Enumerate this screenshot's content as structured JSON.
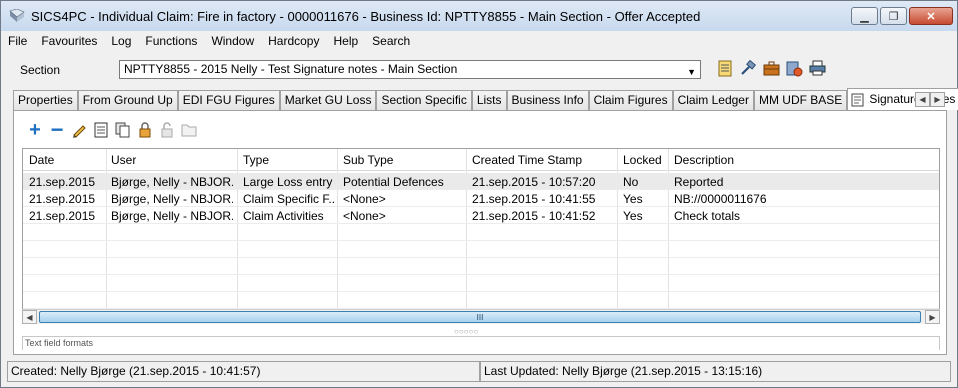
{
  "window": {
    "title": "SICS4PC - Individual Claim: Fire in factory - 0000011676 - Business Id: NPTTY8855 - Main Section - Offer Accepted",
    "controls": [
      "minimize",
      "maximize",
      "close"
    ]
  },
  "menu": [
    "File",
    "Favourites",
    "Log",
    "Functions",
    "Window",
    "Hardcopy",
    "Help",
    "Search"
  ],
  "section": {
    "label": "Section",
    "value": "NPTTY8855 - 2015 Nelly - Test Signature notes - Main Section"
  },
  "tabs": [
    "Properties",
    "From Ground Up",
    "EDI FGU Figures",
    "Market GU Loss",
    "Section Specific",
    "Lists",
    "Business Info",
    "Claim Figures",
    "Claim Ledger",
    "MM UDF BASE",
    "Signature Notes"
  ],
  "active_tab": "Signature Notes",
  "grid": {
    "columns": [
      "Date",
      "User",
      "Type",
      "Sub Type",
      "Created Time Stamp",
      "Locked",
      "Description"
    ],
    "rows": [
      [
        "21.sep.2015",
        "Bjørge, Nelly - NBJOR...",
        "Large Loss entry",
        "Potential Defences",
        "21.sep.2015 - 10:57:20",
        "No",
        "Reported"
      ],
      [
        "21.sep.2015",
        "Bjørge, Nelly - NBJOR...",
        "Claim Specific F...",
        "<None>",
        "21.sep.2015 - 10:41:55",
        "Yes",
        "NB://0000011676"
      ],
      [
        "21.sep.2015",
        "Bjørge, Nelly - NBJOR...",
        "Claim Activities",
        "<None>",
        "21.sep.2015 - 10:41:52",
        "Yes",
        "Check totals"
      ]
    ]
  },
  "scroll": {
    "thumb_label": "III"
  },
  "splitter_label": "○○○○○",
  "textfield_label": "Text field formats",
  "status": {
    "created": "Created: Nelly Bjørge (21.sep.2015 - 10:41:57)",
    "updated": "Last Updated: Nelly Bjørge (21.sep.2015 - 13:15:16)"
  },
  "colors": {
    "title_bar": "#c7d9ee",
    "close_button": "#c74a2f",
    "toolbar_plus": "#1e6fc0",
    "selected_row": "#eaeaea"
  }
}
